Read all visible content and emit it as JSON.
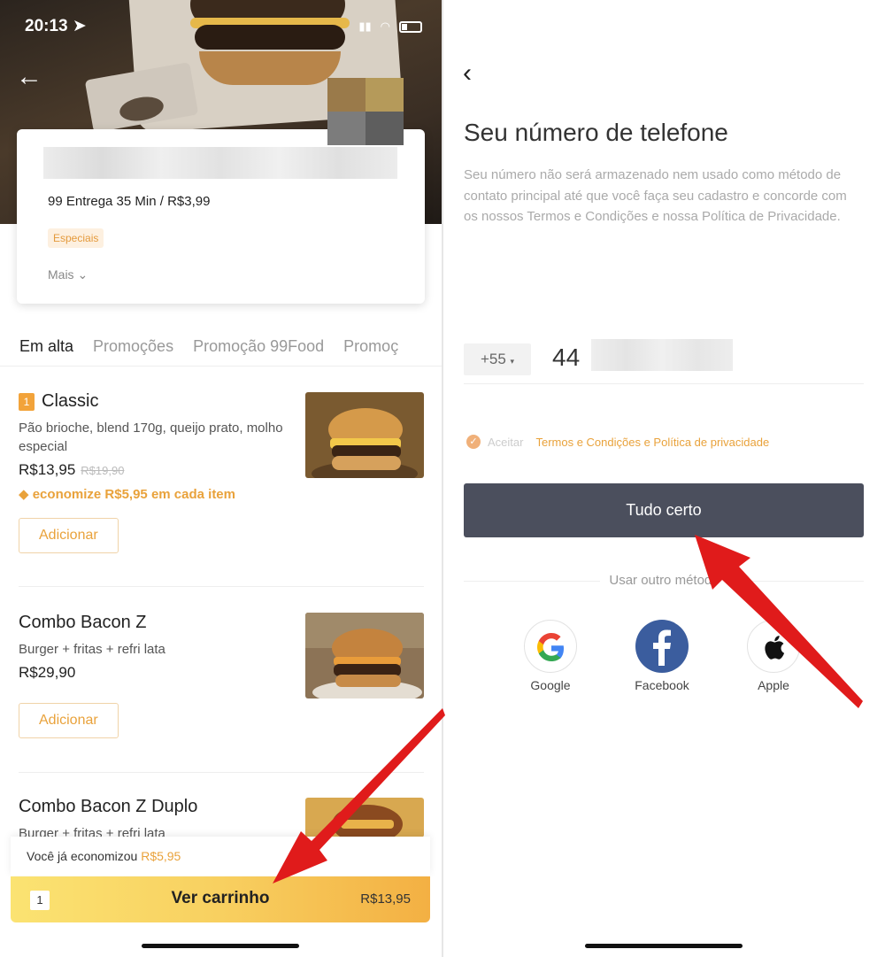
{
  "left": {
    "status": {
      "time": "20:13 ➤"
    },
    "store": {
      "info": "99 Entrega 35 Min / R$3,99",
      "tag": "Especiais",
      "more": "Mais"
    },
    "tabs": [
      "Em alta",
      "Promoções",
      "Promoção 99Food",
      "Promoç"
    ],
    "items": [
      {
        "rank": "1",
        "name": "Classic",
        "desc": "Pão brioche, blend 170g, queijo prato, molho especial",
        "price": "R$13,95",
        "old_price": "R$19,90",
        "saving": "economize R$5,95 em cada item",
        "add": "Adicionar"
      },
      {
        "name": "Combo Bacon Z",
        "desc": "Burger + fritas + refri lata",
        "price": "R$29,90",
        "add": "Adicionar"
      },
      {
        "name": "Combo Bacon Z Duplo",
        "desc": "Burger + fritas + refri lata"
      }
    ],
    "savings": {
      "text": "Você já economizou ",
      "amount": "R$5,95"
    },
    "cart": {
      "qty": "1",
      "label": "Ver carrinho",
      "total": "R$13,95"
    }
  },
  "right": {
    "title": "Seu número de telefone",
    "description": "Seu número não será armazenado nem usado como método de contato principal até que você faça seu cadastro e concorde com os nossos Termos e Condições e nossa Política de Privacidade.",
    "country_code": "+55",
    "phone_prefix": "44",
    "terms": {
      "accept": "Aceitar",
      "link": "Termos e Condições e Política de privacidade"
    },
    "submit": "Tudo certo",
    "other_method": "Usar outro método",
    "social": [
      {
        "label": "Google",
        "icon": "google-icon"
      },
      {
        "label": "Facebook",
        "icon": "facebook-icon"
      },
      {
        "label": "Apple",
        "icon": "apple-icon"
      }
    ]
  },
  "colors": {
    "accent": "#e9a23b",
    "primary_button": "#4b4f5d",
    "annotation_arrow": "#e01b1b",
    "cart_gradient_start": "#fbe372",
    "cart_gradient_end": "#f3b043"
  }
}
